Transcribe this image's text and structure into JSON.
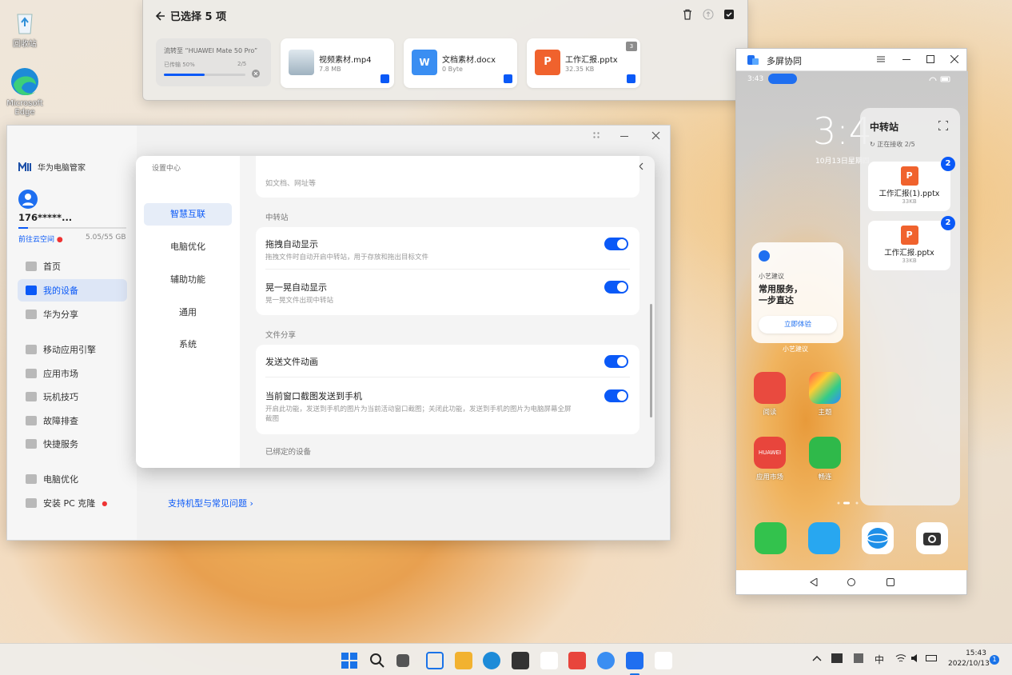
{
  "desktop": {
    "icons": [
      {
        "label": "回收站",
        "icon": "recycle-bin-icon"
      },
      {
        "label": "Microsoft Edge",
        "icon": "edge-icon"
      }
    ]
  },
  "transfer": {
    "title": "已选择 5 项",
    "progress": {
      "target": "流转至 “HUAWEI Mate 50 Pro”",
      "status": "已传输 50%",
      "count": "2/5",
      "percent": 50
    },
    "files": [
      {
        "name": "视频素材.mp4",
        "size": "7.8 MB",
        "icon": "video-thumb-icon"
      },
      {
        "name": "文档素材.docx",
        "size": "0 Byte",
        "icon": "word-icon"
      },
      {
        "name": "工作汇报.pptx",
        "size": "32.35 KB",
        "icon": "ppt-icon",
        "stack": "3"
      }
    ]
  },
  "manager": {
    "app_name": "华为电脑管家",
    "user": "176*****...",
    "cloud_link": "前往云空间",
    "storage": "5.05/55 GB",
    "nav": [
      {
        "label": "首页"
      },
      {
        "label": "我的设备",
        "active": true
      },
      {
        "label": "华为分享"
      },
      {
        "label": "移动应用引擎"
      },
      {
        "label": "应用市场"
      },
      {
        "label": "玩机技巧"
      },
      {
        "label": "故障排查"
      },
      {
        "label": "快捷服务"
      },
      {
        "label": "电脑优化"
      },
      {
        "label": "安装 PC 克隆"
      }
    ],
    "support_link": "支持机型与常见问题 ›"
  },
  "settings": {
    "title": "设置中心",
    "nav": [
      {
        "label": "智慧互联",
        "active": true
      },
      {
        "label": "电脑优化"
      },
      {
        "label": "辅助功能"
      },
      {
        "label": "通用"
      },
      {
        "label": "系统"
      }
    ],
    "top_cut": "如文档、网址等",
    "section1": "中转站",
    "rows1": [
      {
        "title": "拖拽自动显示",
        "desc": "拖拽文件时自动开启中转站，用于存放和拖出目标文件",
        "on": true
      },
      {
        "title": "晃一晃自动显示",
        "desc": "晃一晃文件出现中转站",
        "on": true
      }
    ],
    "section2": "文件分享",
    "rows2": [
      {
        "title": "发送文件动画",
        "desc": "",
        "on": true
      },
      {
        "title": "当前窗口截图发送到手机",
        "desc": "开启此功能，发送到手机的图片为当前活动窗口截图；关闭此功能，发送到手机的图片为电脑屏幕全屏截图",
        "on": true
      }
    ],
    "section3": "已绑定的设备"
  },
  "phone": {
    "window_title": "多屏协同",
    "time": "3:43",
    "clock": "3:4",
    "date": "10月13日星期四",
    "relay": {
      "title": "中转站",
      "status": "正在接收 2/5",
      "files": [
        {
          "name": "工作汇报(1).pptx",
          "size": "33KB",
          "badge": "2"
        },
        {
          "name": "工作汇报.pptx",
          "size": "33KB",
          "badge": "2"
        }
      ]
    },
    "widget": {
      "label": "小艺建议",
      "line1": "常用服务，",
      "line2": "一步直达",
      "button": "立即体验",
      "caption": "小艺建议"
    },
    "apps": [
      {
        "label": "阅读",
        "color": "#e94a3f"
      },
      {
        "label": "主题",
        "color": "#f0a63a"
      },
      {
        "label": "应用市场",
        "color": "#e8453c",
        "text": "HUAWEI"
      },
      {
        "label": "畅连",
        "color": "#2fb94a"
      }
    ],
    "dock": [
      {
        "icon": "phone-icon",
        "color": "#33c24d"
      },
      {
        "icon": "messages-icon",
        "color": "#28a7f0"
      },
      {
        "icon": "browser-icon",
        "color": "#ffffff"
      },
      {
        "icon": "camera-icon",
        "color": "#ffffff"
      }
    ]
  },
  "taskbar": {
    "ime": "中",
    "time": "15:43",
    "date": "2022/10/13",
    "notifications": "1"
  }
}
